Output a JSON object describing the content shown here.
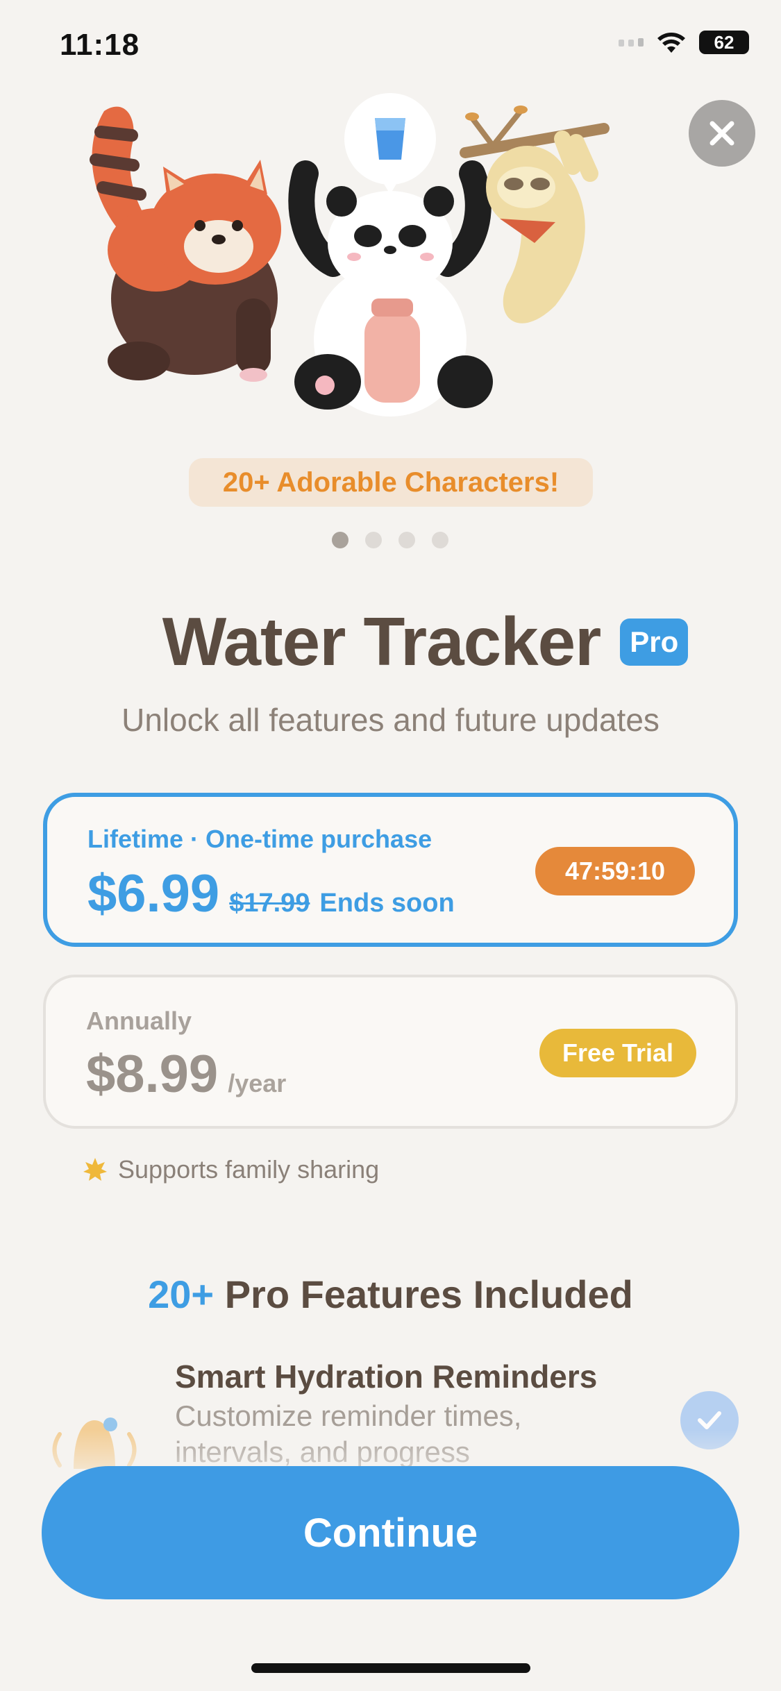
{
  "status_bar": {
    "time": "11:18",
    "battery": "62"
  },
  "carousel": {
    "badge": "20+ Adorable Characters!",
    "page_count": 4,
    "active_page": 1
  },
  "header": {
    "title": "Water Tracker",
    "pro_badge": "Pro",
    "subtitle": "Unlock all features and future updates"
  },
  "plans": {
    "lifetime": {
      "label": "Lifetime · One-time purchase",
      "price": "$6.99",
      "old_price": "$17.99",
      "note": "Ends soon",
      "timer": "47:59:10"
    },
    "annual": {
      "label": "Annually",
      "price": "$8.99",
      "period": "/year",
      "badge": "Free Trial"
    }
  },
  "family_sharing": "Supports family sharing",
  "features": {
    "title_accent": "20+",
    "title_rest": " Pro Features Included",
    "items": [
      {
        "name": "Smart Hydration Reminders",
        "description": "Customize reminder times, intervals, and progress"
      }
    ]
  },
  "cta": {
    "label": "Continue"
  },
  "colors": {
    "accent": "#3e9de3",
    "timer": "#e5893a",
    "trial": "#e8b93a",
    "background": "#f5f3f0"
  }
}
